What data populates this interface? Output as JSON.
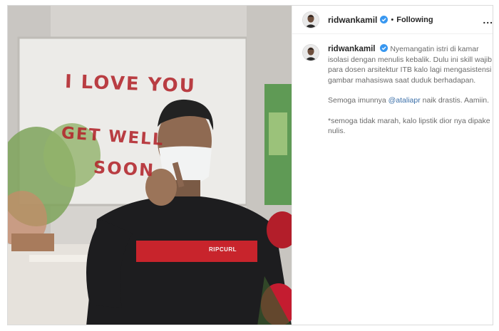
{
  "post": {
    "author": "ridwankamil",
    "follow_status": "Following",
    "separator": "•",
    "more_label": "...",
    "caption": {
      "p1": "Nyemangatin istri di kamar isolasi dengan menulis kebalik. Dulu ini skill wajib para dosen arsitektur ITB kalo lagi mengasistensi gambar mahasiswa saat duduk berhadapan.",
      "p2_before": "Semoga imunnya ",
      "p2_mention": "@ataliapr",
      "p2_after": " naik drastis. Aamiin.",
      "p3": "*semoga tidak marah, kalo lipstik dior nya dipake nulis."
    }
  },
  "media": {
    "line1": "I LOVE YOU",
    "line2": "GET WELL",
    "line3": "SOON",
    "shirt_text": "RIPCURL"
  },
  "colors": {
    "verified": "#3897f0",
    "lipstick": "#b3262c",
    "mention": "#3b6fa8"
  }
}
